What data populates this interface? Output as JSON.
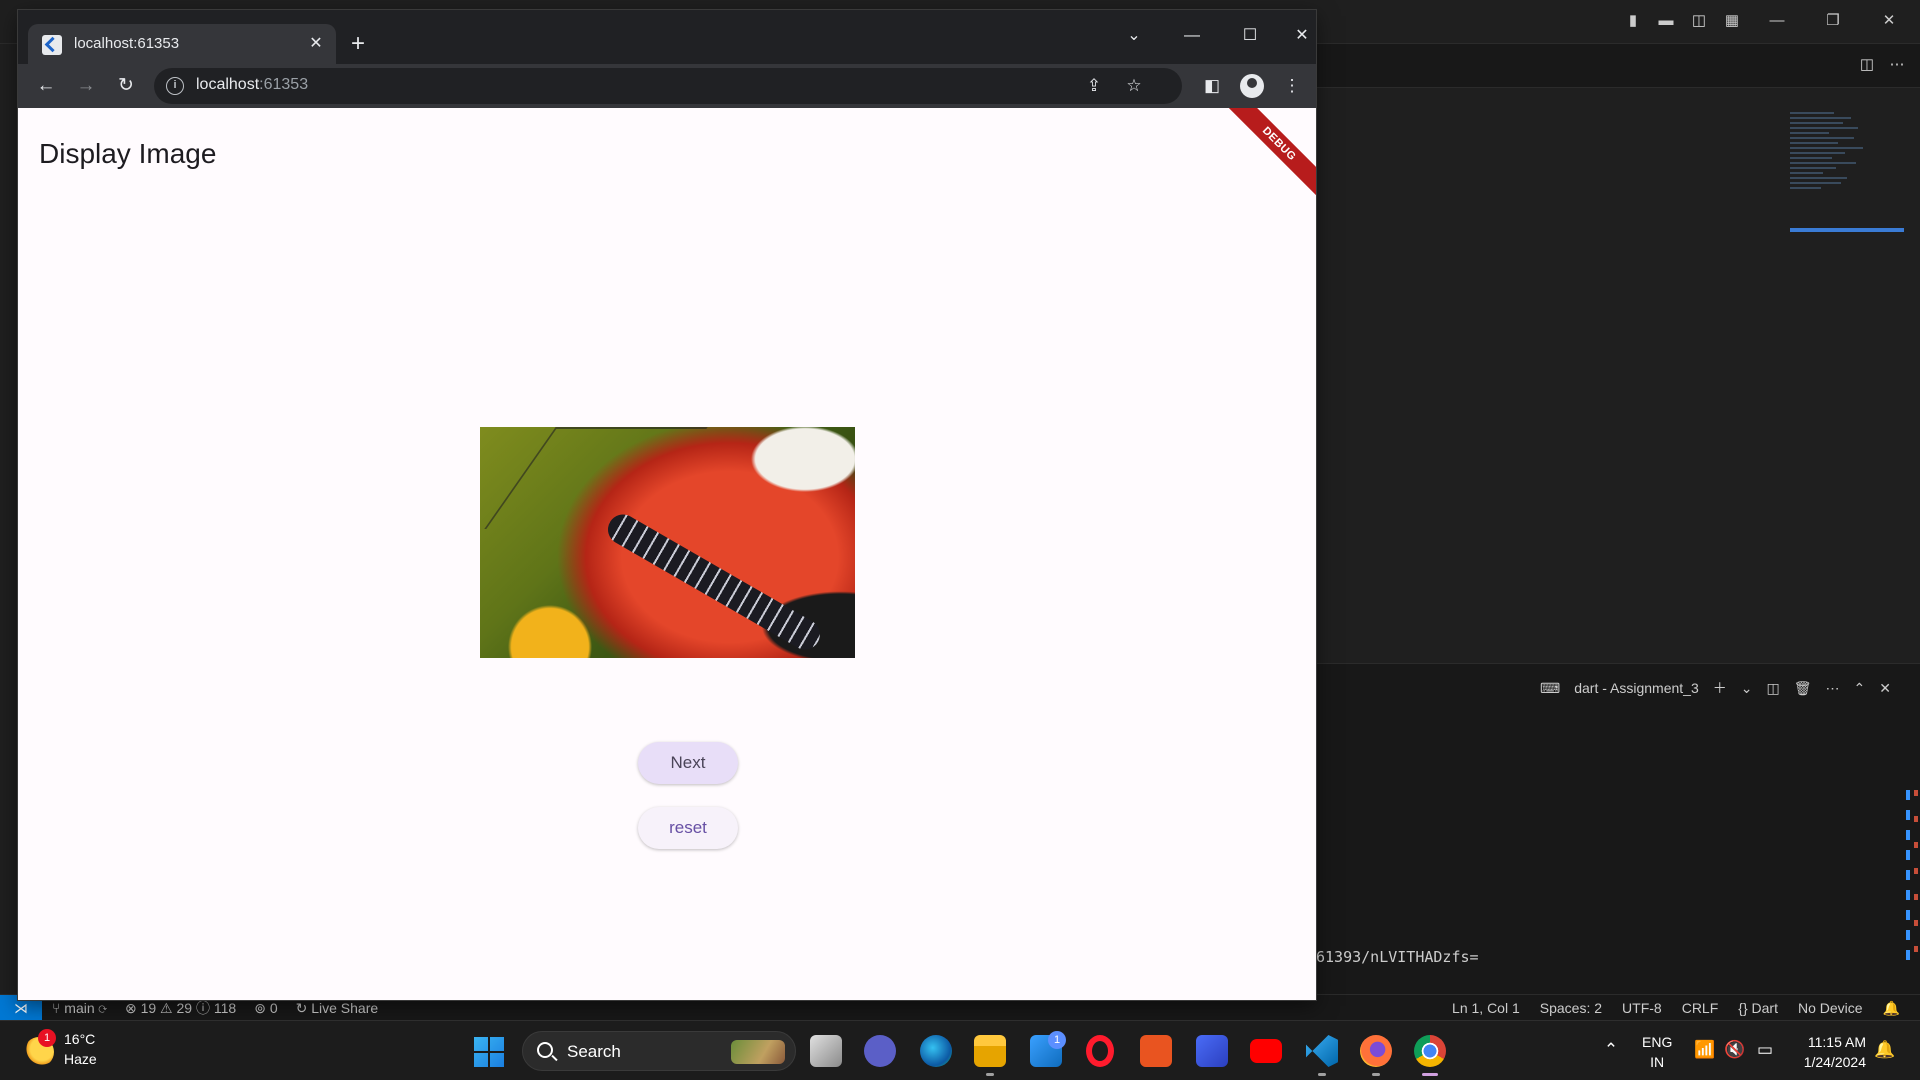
{
  "browser": {
    "tab_title": "localhost:61353",
    "url_host": "localhost",
    "url_port": ":61353"
  },
  "app": {
    "title": "Display Image",
    "debug_banner": "DEBUG",
    "next_label": "Next",
    "reset_label": "reset",
    "image_subject": "butterfly"
  },
  "vscode": {
    "terminal_title": "dart - Assignment_3",
    "terminal_text": "61393/nLVITHADzfs=",
    "status_left": {
      "branch": "main",
      "errors": "19",
      "warnings": "29",
      "infos": "118",
      "ports": "0",
      "live_share": "Live Share"
    },
    "status_right": {
      "position": "Ln 1, Col 1",
      "spaces": "Spaces: 2",
      "encoding": "UTF-8",
      "eol": "CRLF",
      "language": "Dart",
      "device": "No Device"
    }
  },
  "taskbar": {
    "weather_temp": "16°C",
    "weather_condition": "Haze",
    "weather_badge": "1",
    "search_label": "Search",
    "mail_badge": "1",
    "lang_line1": "ENG",
    "lang_line2": "IN",
    "time": "11:15 AM",
    "date": "1/24/2024"
  }
}
